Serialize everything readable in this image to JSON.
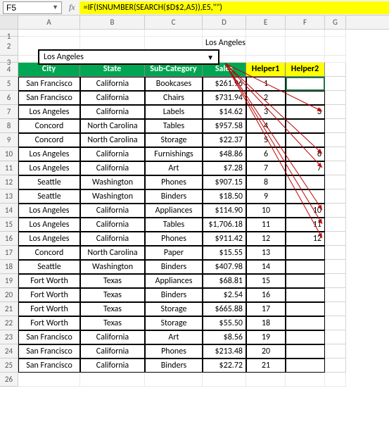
{
  "nameBox": "F5",
  "formula": "=IF(ISNUMBER(SEARCH($D$2,A5)),E5,\"\")",
  "columnLabels": [
    "A",
    "B",
    "C",
    "D",
    "E",
    "F",
    "G"
  ],
  "rowLabels": [
    "1",
    "2",
    "3",
    "4",
    "5",
    "6",
    "7",
    "8",
    "9",
    "10",
    "11",
    "12",
    "13",
    "14",
    "15",
    "16",
    "17",
    "18",
    "19",
    "20",
    "21",
    "22",
    "23",
    "24",
    "25",
    "26"
  ],
  "combo": {
    "value": "Los Angeles"
  },
  "d2": "Los Angeles",
  "headers": [
    "City",
    "State",
    "Sub-Category",
    "Sales",
    "Helper1",
    "Helper2"
  ],
  "rows": [
    {
      "city": "San Francisco",
      "state": "California",
      "sub": "Bookcases",
      "sales": "$261.96",
      "h1": "1",
      "h2": ""
    },
    {
      "city": "San Francisco",
      "state": "California",
      "sub": "Chairs",
      "sales": "$731.94",
      "h1": "2",
      "h2": ""
    },
    {
      "city": "Los Angeles",
      "state": "California",
      "sub": "Labels",
      "sales": "$14.62",
      "h1": "3",
      "h2": "3"
    },
    {
      "city": "Concord",
      "state": "North Carolina",
      "sub": "Tables",
      "sales": "$957.58",
      "h1": "4",
      "h2": ""
    },
    {
      "city": "Concord",
      "state": "North Carolina",
      "sub": "Storage",
      "sales": "$22.37",
      "h1": "5",
      "h2": ""
    },
    {
      "city": "Los Angeles",
      "state": "California",
      "sub": "Furnishings",
      "sales": "$48.86",
      "h1": "6",
      "h2": "6"
    },
    {
      "city": "Los Angeles",
      "state": "California",
      "sub": "Art",
      "sales": "$7.28",
      "h1": "7",
      "h2": "7"
    },
    {
      "city": "Seattle",
      "state": "Washington",
      "sub": "Phones",
      "sales": "$907.15",
      "h1": "8",
      "h2": ""
    },
    {
      "city": "Seattle",
      "state": "Washington",
      "sub": "Binders",
      "sales": "$18.50",
      "h1": "9",
      "h2": ""
    },
    {
      "city": "Los Angeles",
      "state": "California",
      "sub": "Appliances",
      "sales": "$114.90",
      "h1": "10",
      "h2": "10"
    },
    {
      "city": "Los Angeles",
      "state": "California",
      "sub": "Tables",
      "sales": "$1,706.18",
      "h1": "11",
      "h2": "11"
    },
    {
      "city": "Los Angeles",
      "state": "California",
      "sub": "Phones",
      "sales": "$911.42",
      "h1": "12",
      "h2": "12"
    },
    {
      "city": "Concord",
      "state": "North Carolina",
      "sub": "Paper",
      "sales": "$15.55",
      "h1": "13",
      "h2": ""
    },
    {
      "city": "Seattle",
      "state": "Washington",
      "sub": "Binders",
      "sales": "$407.98",
      "h1": "14",
      "h2": ""
    },
    {
      "city": "Fort Worth",
      "state": "Texas",
      "sub": "Appliances",
      "sales": "$68.81",
      "h1": "15",
      "h2": ""
    },
    {
      "city": "Fort Worth",
      "state": "Texas",
      "sub": "Binders",
      "sales": "$2.54",
      "h1": "16",
      "h2": ""
    },
    {
      "city": "Fort Worth",
      "state": "Texas",
      "sub": "Storage",
      "sales": "$665.88",
      "h1": "17",
      "h2": ""
    },
    {
      "city": "Fort Worth",
      "state": "Texas",
      "sub": "Storage",
      "sales": "$55.50",
      "h1": "18",
      "h2": ""
    },
    {
      "city": "San Francisco",
      "state": "California",
      "sub": "Art",
      "sales": "$8.56",
      "h1": "19",
      "h2": ""
    },
    {
      "city": "San Francisco",
      "state": "California",
      "sub": "Phones",
      "sales": "$213.48",
      "h1": "20",
      "h2": ""
    },
    {
      "city": "San Francisco",
      "state": "California",
      "sub": "Binders",
      "sales": "$22.72",
      "h1": "21",
      "h2": ""
    }
  ]
}
